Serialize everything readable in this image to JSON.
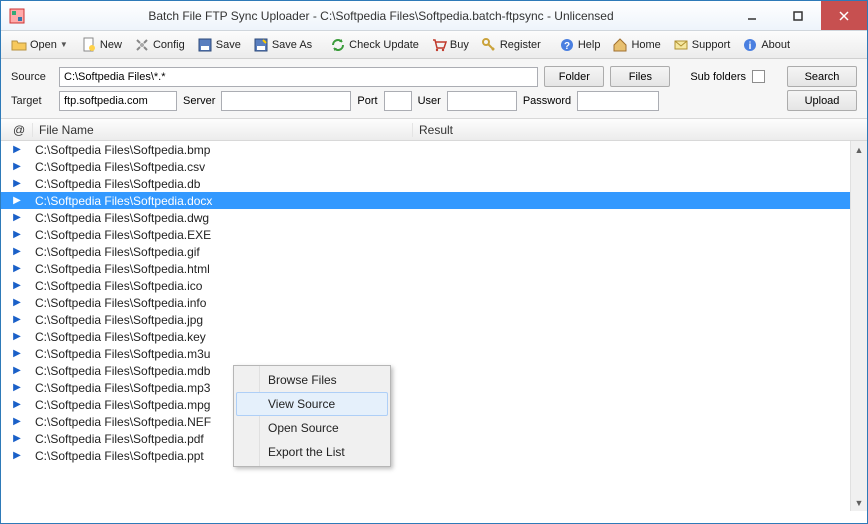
{
  "window": {
    "title": "Batch File FTP Sync Uploader - C:\\Softpedia Files\\Softpedia.batch-ftpsync - Unlicensed"
  },
  "toolbar": {
    "open": "Open",
    "new": "New",
    "config": "Config",
    "save": "Save",
    "save_as": "Save As",
    "check_update": "Check Update",
    "buy": "Buy",
    "register": "Register",
    "help": "Help",
    "home": "Home",
    "support": "Support",
    "about": "About"
  },
  "filters": {
    "source_label": "Source",
    "source_value": "C:\\Softpedia Files\\*.*",
    "folder_btn": "Folder",
    "files_btn": "Files",
    "subfolders_label": "Sub folders",
    "search_btn": "Search",
    "target_label": "Target",
    "target_value": "ftp.softpedia.com",
    "server_label": "Server",
    "server_value": "",
    "port_label": "Port",
    "port_value": "",
    "user_label": "User",
    "user_value": "",
    "password_label": "Password",
    "password_value": "",
    "upload_btn": "Upload"
  },
  "columns": {
    "at": "@",
    "filename": "File Name",
    "result": "Result"
  },
  "files": [
    "C:\\Softpedia Files\\Softpedia.bmp",
    "C:\\Softpedia Files\\Softpedia.csv",
    "C:\\Softpedia Files\\Softpedia.db",
    "C:\\Softpedia Files\\Softpedia.docx",
    "C:\\Softpedia Files\\Softpedia.dwg",
    "C:\\Softpedia Files\\Softpedia.EXE",
    "C:\\Softpedia Files\\Softpedia.gif",
    "C:\\Softpedia Files\\Softpedia.html",
    "C:\\Softpedia Files\\Softpedia.ico",
    "C:\\Softpedia Files\\Softpedia.info",
    "C:\\Softpedia Files\\Softpedia.jpg",
    "C:\\Softpedia Files\\Softpedia.key",
    "C:\\Softpedia Files\\Softpedia.m3u",
    "C:\\Softpedia Files\\Softpedia.mdb",
    "C:\\Softpedia Files\\Softpedia.mp3",
    "C:\\Softpedia Files\\Softpedia.mpg",
    "C:\\Softpedia Files\\Softpedia.NEF",
    "C:\\Softpedia Files\\Softpedia.pdf",
    "C:\\Softpedia Files\\Softpedia.ppt"
  ],
  "selected_index": 3,
  "context_menu": {
    "items": [
      "Browse Files",
      "View  Source",
      "Open Source",
      "Export the List"
    ],
    "hover_index": 1
  }
}
